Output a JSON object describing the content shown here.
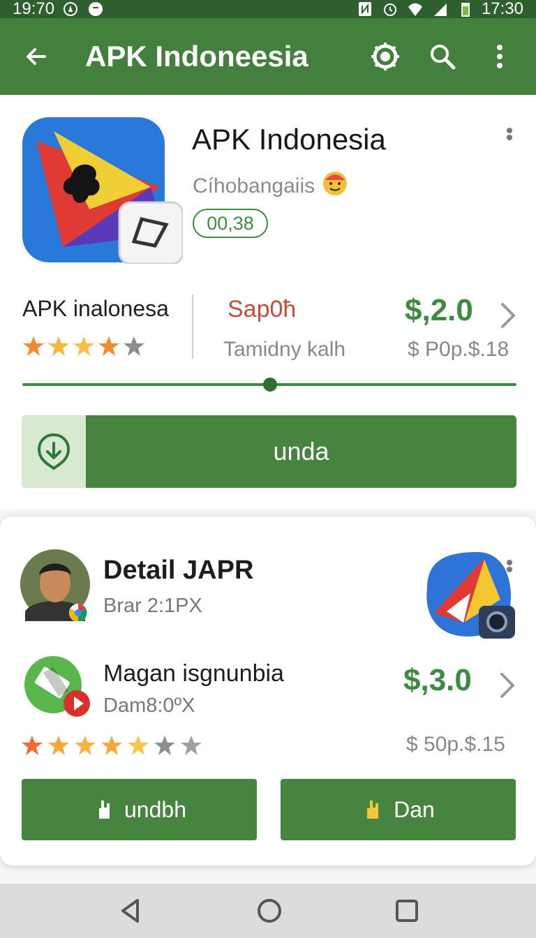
{
  "status_bar": {
    "time_left": "19:70",
    "time_right": "17:30"
  },
  "app_bar": {
    "title": "APK Indoneesia"
  },
  "app": {
    "name": "APK Indonesia",
    "developer": "Cíhobangaiis",
    "version": "00,38",
    "info_name": "APK inalonesa",
    "rating_stars": 4,
    "status": "Sap0ћ",
    "sub_status": "Tamidny kalh",
    "price": "$,2.0",
    "price_sub": "$ P0p.$.18",
    "progress": 0.51,
    "download_label": "unda"
  },
  "detail": {
    "title": "Detail JAPR",
    "subtitle": "Brar 2:1PX",
    "app2_name": "Magan isgnunbia",
    "app2_sub": "Dam8:0ºX",
    "app2_price": "$,3.0",
    "app2_price_sub": "$ 50p.$.15",
    "app2_rating_stars": 5,
    "app2_total_stars": 7,
    "button_left": "undbh",
    "button_right": "Dan"
  },
  "colors": {
    "primary": "#43803e",
    "accent_green": "#3d8b40",
    "status_red": "#c64c3b",
    "star_gold": "#f3b43a"
  }
}
